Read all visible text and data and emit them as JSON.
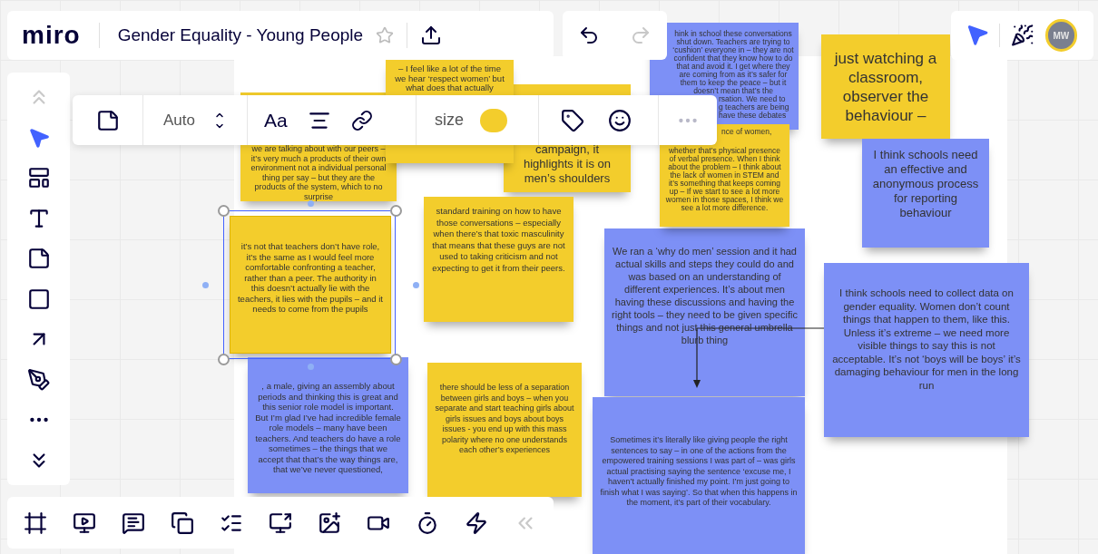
{
  "header": {
    "logo": "miro",
    "board_title": "Gender Equality - Young People",
    "starred": false
  },
  "history": {
    "undo_disabled": false,
    "redo_disabled": true
  },
  "user": {
    "initials": "MW"
  },
  "tools": [
    {
      "selected": false,
      "disabled": true
    },
    {
      "selected": true,
      "disabled": false
    },
    {
      "selected": false,
      "disabled": false
    },
    {
      "selected": false,
      "disabled": false
    },
    {
      "selected": false,
      "disabled": false
    },
    {
      "selected": false,
      "disabled": false
    },
    {
      "selected": false,
      "disabled": false
    },
    {
      "selected": false,
      "disabled": false
    },
    {
      "selected": false,
      "disabled": false
    },
    {
      "selected": false,
      "disabled": false
    }
  ],
  "context_toolbar": {
    "font_size": "Auto",
    "font_button": "Aa",
    "size_label": "size"
  },
  "notes": [
    {
      "color": "#f3cd2c",
      "selected": false,
      "text": "we are talking about with our peers – it’s very much a products of their own environment not a individual personal thing per say – but they are the products of the system, which to no surprise"
    },
    {
      "color": "#f3cd2c",
      "selected": false,
      "text": "– I feel like a lot of the time we hear ‘respect women’ but what does that actually"
    },
    {
      "color": "#f3cd2c",
      "selected": false,
      "text": "campaign, it highlights it is on men’s shoulders"
    },
    {
      "color": "#7d90f6",
      "selected": false,
      "text": "hink in school these conversations shut down. Teachers are trying to ‘cushion’ everyone in – they are not confident that they know how to do that and avoid it. I get where they are coming from as it’s safer for them to keep the peace – but it doesn’t mean that’s the",
      "tail_fragments": [
        "rsation. We need to",
        "g teachers are being",
        "have these debates"
      ]
    },
    {
      "color": "#f3cd2c",
      "selected": false,
      "lead_fragments": [
        "nce of women,"
      ],
      "text": "whether that’s physical presence of verbal presence. When I think about the problem – I think about the lack of women in STEM and it’s something that keeps coming up – If we start to see a lot more women in those spaces, I think we see a lot more difference."
    },
    {
      "color": "#f3cd2c",
      "selected": false,
      "text": "just watching a classroom, observer the behaviour –"
    },
    {
      "color": "#7d90f6",
      "selected": false,
      "text": "I think schools need an effective and anonymous process for reporting behaviour"
    },
    {
      "color": "#f3cd2c",
      "selected": true,
      "text": "it’s not that teachers don’t have role, it’s the same as I would feel more comfortable confronting a teacher, rather than a peer. The authority in this doesn’t actually lie with the teachers, it lies with the pupils – and it needs to come from the pupils"
    },
    {
      "color": "#f3cd2c",
      "selected": false,
      "text": "standard training on how to have those conversations – especially when there’s that toxic masculinity that means that these guys are not used to taking criticism and not expecting to get it from their peers."
    },
    {
      "color": "#7d90f6",
      "selected": false,
      "text": "We ran a ‘why do men’ session and it had actual skills and steps they could do and was based on an understanding of different experiences. It’s about men having these discussions and having the right tools – they need to be given specific things and not just this general umbrella blurb thing"
    },
    {
      "color": "#7d90f6",
      "selected": false,
      "text": "I think schools need to collect data on gender equality. Women don’t count things that happen to them, like this. Unless it’s extreme – we need more visible things to say this is not acceptable. It’s not ‘boys will be boys’ it’s damaging behaviour for men in the long run"
    },
    {
      "color": "#7d90f6",
      "selected": false,
      "text": ", a male, giving an assembly about periods and thinking this is great and this senior role model is important. But I’m glad I’ve had incredible female role models – many have been teachers. And teachers do have a role sometimes – the things that we accept that that’s the way things are, that we’ve never questioned,"
    },
    {
      "color": "#f3cd2c",
      "selected": false,
      "text": "there should be less of a separation between girls and boys – when you separate and start teaching girls about girls issues and boys about boys issues - you end up with this mass polarity where no one understands each other’s experiences"
    },
    {
      "color": "#7d90f6",
      "selected": false,
      "text": "Sometimes it’s literally like giving people the right sentences to say – in one of the actions from the  empowered training sessions I was part of – was girls actual practising saying the sentence ‘excuse me, I haven’t actually finished my point. I’m just going to finish what I was saying’. So that when this happens in the moment, it’s part of their vocabulary."
    }
  ]
}
